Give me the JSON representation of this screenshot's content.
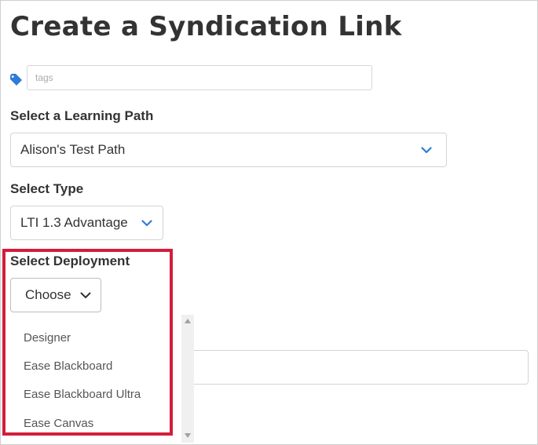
{
  "page": {
    "title": "Create a Syndication Link"
  },
  "tags": {
    "placeholder": "tags"
  },
  "learning_path": {
    "label": "Select a Learning Path",
    "selected": "Alison's Test Path"
  },
  "type": {
    "label": "Select Type",
    "selected": "LTI 1.3 Advantage"
  },
  "deployment": {
    "label": "Select Deployment",
    "selected": "Choose",
    "options": [
      "Designer",
      "Ease Blackboard",
      "Ease Blackboard Ultra",
      "Ease Canvas"
    ]
  },
  "colors": {
    "accent": "#2f7bd9",
    "highlight": "#d31d3b",
    "text": "#333333"
  },
  "icons": {
    "tag": "tag-icon",
    "chevron": "chevron-down-icon"
  }
}
